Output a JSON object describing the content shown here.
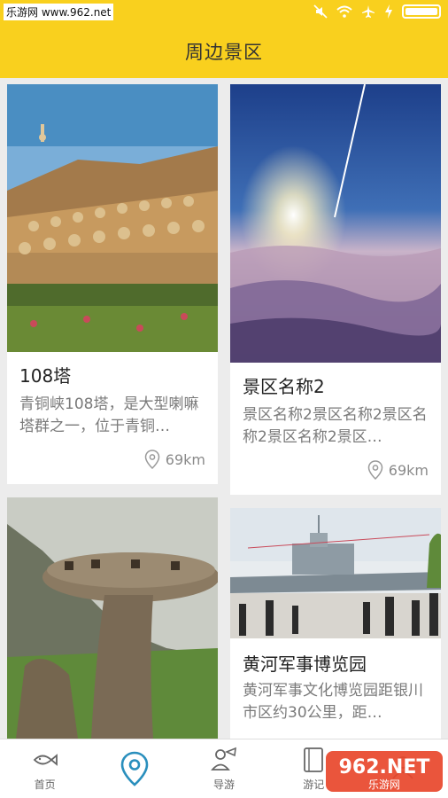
{
  "status_bar": {
    "watermark": "乐游网 www.962.net",
    "icons": [
      "mute-icon",
      "wifi-icon",
      "airplane-icon",
      "charging-icon",
      "battery-icon"
    ]
  },
  "header": {
    "title": "周边景区"
  },
  "cards": [
    {
      "title": "108塔",
      "desc": "青铜峡108塔，是大型喇嘛塔群之一，位于青铜…",
      "distance": "69km"
    },
    {
      "title": "景区名称2",
      "desc": "景区名称2景区名称2景区名称2景区名称2景区…",
      "distance": "69km"
    },
    {
      "title": "",
      "desc": "",
      "distance": ""
    },
    {
      "title": "黄河军事博览园",
      "desc": "黄河军事文化博览园距银川市区约30公里，距…",
      "distance": ""
    }
  ],
  "tabs": [
    {
      "label": "首页",
      "icon": "fish-icon"
    },
    {
      "label": "",
      "icon": "location-pin-icon"
    },
    {
      "label": "导游",
      "icon": "guide-icon"
    },
    {
      "label": "游记",
      "icon": "notebook-icon"
    },
    {
      "label": "",
      "icon": "profile-icon"
    }
  ],
  "logo": {
    "text": "962.NET",
    "subtext": "乐游网"
  },
  "colors": {
    "accent": "#f9d01e",
    "active_tab": "#2a8fbd"
  }
}
